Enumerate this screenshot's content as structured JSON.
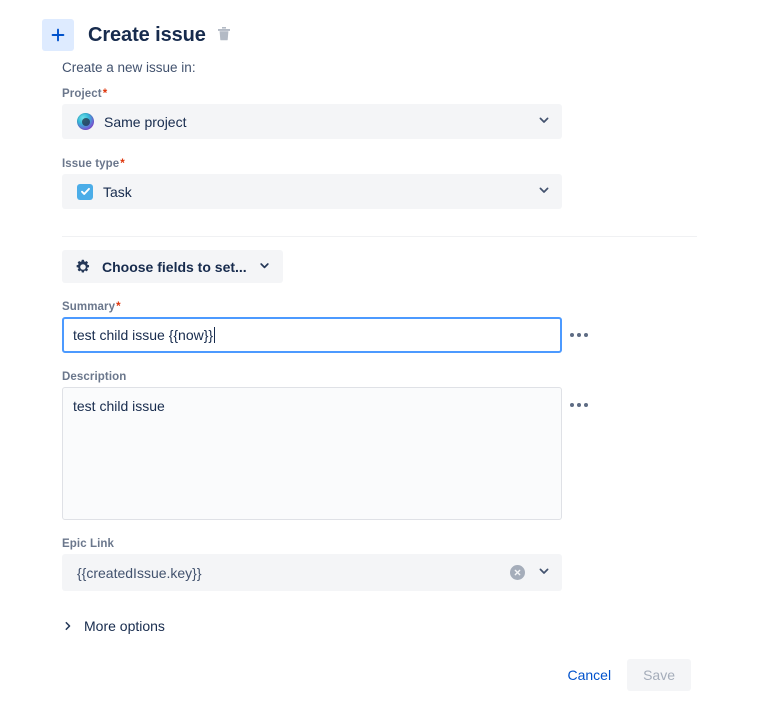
{
  "header": {
    "add_icon": "plus-icon",
    "title": "Create issue",
    "delete_icon": "trash-icon"
  },
  "form": {
    "subtitle": "Create a new issue in:",
    "project": {
      "label": "Project",
      "required_marker": "*",
      "value": "Same project",
      "avatar_icon": "project-avatar-icon",
      "chevron_icon": "chevron-down-icon"
    },
    "issue_type": {
      "label": "Issue type",
      "required_marker": "*",
      "value": "Task",
      "type_icon": "task-icon",
      "chevron_icon": "chevron-down-icon"
    },
    "choose_fields": {
      "label": "Choose fields to set...",
      "gear_icon": "gear-icon",
      "chevron_icon": "chevron-down-icon"
    },
    "summary": {
      "label": "Summary",
      "required_marker": "*",
      "value": "test child issue {{now}}",
      "placeholder": "",
      "more_icon": "ellipsis-icon"
    },
    "description": {
      "label": "Description",
      "value": "test child issue",
      "placeholder": "",
      "more_icon": "ellipsis-icon"
    },
    "epic_link": {
      "label": "Epic Link",
      "value": "{{createdIssue.key}}",
      "clear_icon": "clear-circle-icon",
      "chevron_icon": "chevron-down-icon"
    },
    "more_options": {
      "label": "More options",
      "chevron_icon": "chevron-right-icon"
    }
  },
  "footer": {
    "cancel_label": "Cancel",
    "save_label": "Save"
  },
  "colors": {
    "accent": "#0052cc",
    "focus_border": "#4c9aff",
    "field_bg": "#f4f5f7",
    "required": "#de350b",
    "task_icon": "#4bade8",
    "plus_bg": "#deebff"
  }
}
